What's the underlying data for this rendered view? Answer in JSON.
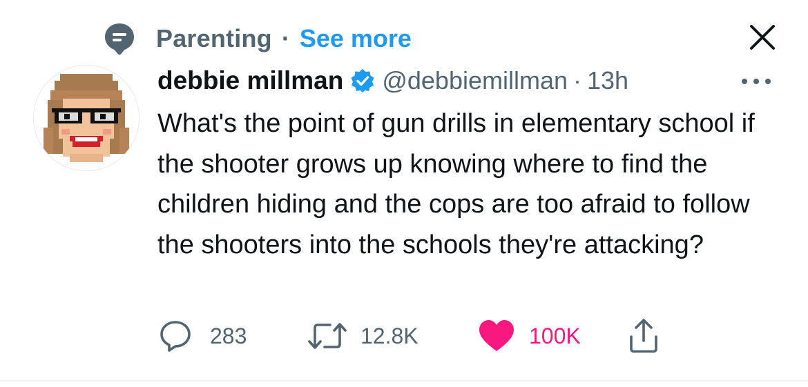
{
  "topic": {
    "icon": "topic-icon",
    "label": "Parenting",
    "separator": "·",
    "see_more": "See more"
  },
  "tweet": {
    "author": {
      "name": "debbie millman",
      "verified": true,
      "handle": "@debbiemillman",
      "avatar": "pixel-art-avatar"
    },
    "separator": "·",
    "time": "13h",
    "text": "What's the point of gun drills in elementary school if the shooter grows up knowing where to find the children hiding and the cops are too afraid to follow the shooters into the schools they're attacking?",
    "actions": {
      "replies": "283",
      "retweets": "12.8K",
      "likes": "100K",
      "liked": true
    }
  },
  "colors": {
    "text": "#0f1419",
    "secondary": "#536471",
    "link": "#1d9bf0",
    "like": "#f91880",
    "verified": "#1d9bf0"
  }
}
